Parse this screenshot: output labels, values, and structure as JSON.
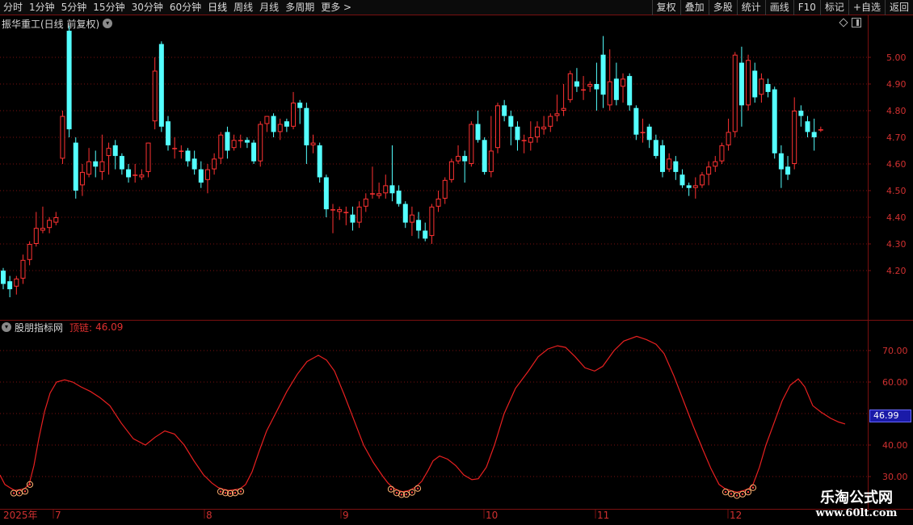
{
  "toolbar": {
    "periods": [
      "分时",
      "1分钟",
      "5分钟",
      "15分钟",
      "30分钟",
      "60分钟",
      "日线",
      "周线",
      "月线",
      "多周期",
      "更多 >"
    ],
    "active_period": "日线",
    "right_buttons": [
      "复权",
      "叠加",
      "多股",
      "统计",
      "画线",
      "F10",
      "标记",
      "+自选",
      "返回"
    ]
  },
  "main_chart": {
    "title": "振华重工(日线 前复权)",
    "price_ticks": [
      "5.00",
      "4.90",
      "4.80",
      "4.70",
      "4.60",
      "4.50",
      "4.40",
      "4.30",
      "4.20"
    ]
  },
  "sub_chart": {
    "title": "股朋指标网",
    "indicator_label": "顶链:",
    "indicator_value": "46.09",
    "ticks": [
      "70.00",
      "60.00",
      "40.00",
      "30.00"
    ],
    "current_value_box": "46.99"
  },
  "date_axis": [
    "2025年",
    "7",
    "8",
    "9",
    "10",
    "11",
    "12"
  ],
  "watermark": {
    "line1": "乐淘公式网",
    "line2": "www.60lt.com"
  },
  "colors": {
    "up": "#ff3232",
    "down": "#54ffff",
    "indicator": "#e82020",
    "grid": "#7a1010",
    "axis_text": "#d03030"
  },
  "chart_data": [
    {
      "type": "candlestick",
      "title": "振华重工(日线 前复权)",
      "ylim": [
        4.07,
        5.13
      ],
      "candles": [
        [
          4.2,
          4.15,
          4.21,
          4.13
        ],
        [
          4.16,
          4.13,
          4.18,
          4.1
        ],
        [
          4.14,
          4.17,
          4.18,
          4.11
        ],
        [
          4.17,
          4.24,
          4.26,
          4.15
        ],
        [
          4.24,
          4.3,
          4.31,
          4.22
        ],
        [
          4.3,
          4.36,
          4.42,
          4.29
        ],
        [
          4.35,
          4.36,
          4.44,
          4.34
        ],
        [
          4.36,
          4.39,
          4.4,
          4.34
        ],
        [
          4.38,
          4.4,
          4.42,
          4.37
        ],
        [
          4.62,
          4.78,
          4.8,
          4.6
        ],
        [
          5.1,
          4.73,
          5.12,
          4.7
        ],
        [
          4.68,
          4.5,
          4.7,
          4.47
        ],
        [
          4.52,
          4.57,
          4.6,
          4.48
        ],
        [
          4.56,
          4.61,
          4.66,
          4.55
        ],
        [
          4.61,
          4.59,
          4.65,
          4.55
        ],
        [
          4.57,
          4.61,
          4.71,
          4.54
        ],
        [
          4.63,
          4.66,
          4.68,
          4.56
        ],
        [
          4.67,
          4.63,
          4.69,
          4.58
        ],
        [
          4.63,
          4.58,
          4.64,
          4.56
        ],
        [
          4.58,
          4.55,
          4.6,
          4.53
        ],
        [
          4.56,
          4.56,
          4.6,
          4.53
        ],
        [
          4.55,
          4.56,
          4.58,
          4.54
        ],
        [
          4.57,
          4.68,
          4.68,
          4.55
        ],
        [
          4.76,
          4.95,
          5.0,
          4.73
        ],
        [
          5.05,
          4.74,
          5.06,
          4.72
        ],
        [
          4.76,
          4.67,
          4.78,
          4.65
        ],
        [
          4.66,
          4.66,
          4.7,
          4.62
        ],
        [
          4.65,
          4.65,
          4.67,
          4.62
        ],
        [
          4.65,
          4.61,
          4.66,
          4.59
        ],
        [
          4.62,
          4.58,
          4.65,
          4.56
        ],
        [
          4.58,
          4.53,
          4.61,
          4.51
        ],
        [
          4.54,
          4.58,
          4.6,
          4.49
        ],
        [
          4.58,
          4.62,
          4.64,
          4.56
        ],
        [
          4.62,
          4.71,
          4.72,
          4.6
        ],
        [
          4.72,
          4.65,
          4.74,
          4.62
        ],
        [
          4.66,
          4.69,
          4.71,
          4.65
        ],
        [
          4.69,
          4.69,
          4.71,
          4.66
        ],
        [
          4.69,
          4.68,
          4.7,
          4.66
        ],
        [
          4.68,
          4.61,
          4.69,
          4.6
        ],
        [
          4.61,
          4.75,
          4.76,
          4.59
        ],
        [
          4.75,
          4.78,
          4.78,
          4.72
        ],
        [
          4.78,
          4.72,
          4.79,
          4.7
        ],
        [
          4.72,
          4.75,
          4.77,
          4.69
        ],
        [
          4.76,
          4.74,
          4.77,
          4.72
        ],
        [
          4.74,
          4.83,
          4.87,
          4.73
        ],
        [
          4.83,
          4.81,
          4.84,
          4.75
        ],
        [
          4.81,
          4.67,
          4.83,
          4.6
        ],
        [
          4.67,
          4.68,
          4.71,
          4.64
        ],
        [
          4.67,
          4.55,
          4.68,
          4.53
        ],
        [
          4.55,
          4.43,
          4.56,
          4.4
        ],
        [
          4.43,
          4.43,
          4.45,
          4.34
        ],
        [
          4.42,
          4.43,
          4.44,
          4.39
        ],
        [
          4.42,
          4.42,
          4.44,
          4.37
        ],
        [
          4.41,
          4.38,
          4.44,
          4.35
        ],
        [
          4.38,
          4.44,
          4.46,
          4.36
        ],
        [
          4.44,
          4.47,
          4.49,
          4.42
        ],
        [
          4.49,
          4.49,
          4.59,
          4.47
        ],
        [
          4.48,
          4.49,
          4.53,
          4.47
        ],
        [
          4.49,
          4.52,
          4.56,
          4.47
        ],
        [
          4.52,
          4.49,
          4.67,
          4.46
        ],
        [
          4.5,
          4.45,
          4.52,
          4.44
        ],
        [
          4.45,
          4.38,
          4.46,
          4.36
        ],
        [
          4.38,
          4.41,
          4.44,
          4.33
        ],
        [
          4.39,
          4.35,
          4.42,
          4.32
        ],
        [
          4.35,
          4.32,
          4.38,
          4.31
        ],
        [
          4.33,
          4.44,
          4.45,
          4.3
        ],
        [
          4.44,
          4.47,
          4.5,
          4.42
        ],
        [
          4.47,
          4.54,
          4.55,
          4.45
        ],
        [
          4.54,
          4.61,
          4.62,
          4.53
        ],
        [
          4.61,
          4.63,
          4.67,
          4.6
        ],
        [
          4.63,
          4.61,
          4.65,
          4.53
        ],
        [
          4.6,
          4.75,
          4.76,
          4.59
        ],
        [
          4.75,
          4.69,
          4.8,
          4.68
        ],
        [
          4.69,
          4.57,
          4.7,
          4.56
        ],
        [
          4.57,
          4.65,
          4.78,
          4.55
        ],
        [
          4.66,
          4.82,
          4.83,
          4.64
        ],
        [
          4.82,
          4.78,
          4.84,
          4.76
        ],
        [
          4.78,
          4.74,
          4.8,
          4.67
        ],
        [
          4.74,
          4.69,
          4.76,
          4.65
        ],
        [
          4.69,
          4.69,
          4.71,
          4.64
        ],
        [
          4.68,
          4.7,
          4.76,
          4.65
        ],
        [
          4.7,
          4.74,
          4.76,
          4.68
        ],
        [
          4.73,
          4.74,
          4.78,
          4.71
        ],
        [
          4.74,
          4.78,
          4.79,
          4.72
        ],
        [
          4.78,
          4.79,
          4.86,
          4.76
        ],
        [
          4.8,
          4.81,
          4.9,
          4.78
        ],
        [
          4.84,
          4.94,
          4.95,
          4.83
        ],
        [
          4.91,
          4.89,
          4.96,
          4.87
        ],
        [
          4.88,
          4.88,
          4.93,
          4.84
        ],
        [
          4.89,
          4.9,
          4.91,
          4.87
        ],
        [
          4.9,
          4.88,
          4.98,
          4.8
        ],
        [
          5.01,
          4.86,
          5.08,
          4.81
        ],
        [
          4.82,
          4.91,
          5.03,
          4.8
        ],
        [
          4.92,
          4.84,
          4.98,
          4.82
        ],
        [
          4.89,
          4.92,
          4.94,
          4.83
        ],
        [
          4.93,
          4.82,
          4.94,
          4.8
        ],
        [
          4.81,
          4.71,
          4.82,
          4.69
        ],
        [
          4.72,
          4.72,
          4.77,
          4.68
        ],
        [
          4.74,
          4.69,
          4.75,
          4.66
        ],
        [
          4.69,
          4.63,
          4.71,
          4.62
        ],
        [
          4.67,
          4.57,
          4.69,
          4.55
        ],
        [
          4.58,
          4.62,
          4.64,
          4.57
        ],
        [
          4.61,
          4.57,
          4.63,
          4.54
        ],
        [
          4.56,
          4.52,
          4.58,
          4.51
        ],
        [
          4.52,
          4.51,
          4.53,
          4.48
        ],
        [
          4.51,
          4.52,
          4.55,
          4.47
        ],
        [
          4.52,
          4.56,
          4.57,
          4.51
        ],
        [
          4.56,
          4.59,
          4.61,
          4.52
        ],
        [
          4.59,
          4.61,
          4.63,
          4.57
        ],
        [
          4.61,
          4.67,
          4.68,
          4.6
        ],
        [
          4.67,
          4.72,
          4.77,
          4.65
        ],
        [
          4.72,
          5.01,
          5.02,
          4.7
        ],
        [
          4.98,
          4.82,
          5.04,
          4.74
        ],
        [
          4.82,
          4.99,
          5.01,
          4.8
        ],
        [
          4.95,
          4.85,
          4.98,
          4.83
        ],
        [
          4.86,
          4.92,
          4.94,
          4.83
        ],
        [
          4.9,
          4.87,
          4.92,
          4.85
        ],
        [
          4.88,
          4.64,
          4.89,
          4.62
        ],
        [
          4.64,
          4.58,
          4.67,
          4.51
        ],
        [
          4.59,
          4.56,
          4.63,
          4.54
        ],
        [
          4.6,
          4.8,
          4.85,
          4.58
        ],
        [
          4.8,
          4.78,
          4.82,
          4.74
        ],
        [
          4.76,
          4.72,
          4.78,
          4.7
        ],
        [
          4.72,
          4.7,
          4.77,
          4.65
        ],
        [
          4.73,
          4.73,
          4.74,
          4.72
        ]
      ]
    },
    {
      "type": "line",
      "series": [
        {
          "name": "顶链",
          "color": "#e82020"
        }
      ],
      "ylim": [
        24,
        77
      ],
      "points": [
        [
          0,
          30.5
        ],
        [
          6,
          27.5
        ],
        [
          12,
          26.5
        ],
        [
          18,
          25.6
        ],
        [
          24,
          25.8
        ],
        [
          30,
          26.1
        ],
        [
          36,
          27.5
        ],
        [
          42,
          33.5
        ],
        [
          48,
          42.0
        ],
        [
          55,
          50.5
        ],
        [
          62,
          56.5
        ],
        [
          70,
          60.0
        ],
        [
          80,
          60.7
        ],
        [
          90,
          60.0
        ],
        [
          100,
          58.5
        ],
        [
          112,
          57.0
        ],
        [
          124,
          55.0
        ],
        [
          136,
          52.5
        ],
        [
          150,
          47.0
        ],
        [
          165,
          42.0
        ],
        [
          180,
          40.0
        ],
        [
          192,
          42.5
        ],
        [
          204,
          44.5
        ],
        [
          216,
          43.5
        ],
        [
          228,
          40.0
        ],
        [
          240,
          35.0
        ],
        [
          252,
          30.5
        ],
        [
          262,
          28.0
        ],
        [
          270,
          26.5
        ],
        [
          276,
          26.0
        ],
        [
          283,
          25.6
        ],
        [
          290,
          25.8
        ],
        [
          297,
          26.1
        ],
        [
          304,
          27.5
        ],
        [
          312,
          31.5
        ],
        [
          320,
          37.5
        ],
        [
          330,
          44.5
        ],
        [
          342,
          50.5
        ],
        [
          355,
          57.0
        ],
        [
          368,
          62.5
        ],
        [
          380,
          66.5
        ],
        [
          394,
          68.5
        ],
        [
          404,
          67.0
        ],
        [
          414,
          63.5
        ],
        [
          426,
          56.0
        ],
        [
          438,
          48.0
        ],
        [
          450,
          40.0
        ],
        [
          462,
          34.5
        ],
        [
          474,
          30.0
        ],
        [
          480,
          28.0
        ],
        [
          486,
          26.5
        ],
        [
          492,
          25.7
        ],
        [
          498,
          25.2
        ],
        [
          504,
          25.4
        ],
        [
          510,
          26.0
        ],
        [
          516,
          27.0
        ],
        [
          522,
          28.5
        ],
        [
          530,
          32.0
        ],
        [
          536,
          35.0
        ],
        [
          544,
          36.5
        ],
        [
          554,
          35.5
        ],
        [
          564,
          33.5
        ],
        [
          574,
          30.5
        ],
        [
          584,
          29.0
        ],
        [
          592,
          29.3
        ],
        [
          602,
          33.0
        ],
        [
          612,
          40.0
        ],
        [
          624,
          50.0
        ],
        [
          638,
          58.0
        ],
        [
          654,
          63.5
        ],
        [
          666,
          68.0
        ],
        [
          678,
          70.5
        ],
        [
          690,
          71.5
        ],
        [
          700,
          71.0
        ],
        [
          712,
          68.0
        ],
        [
          724,
          64.5
        ],
        [
          736,
          63.5
        ],
        [
          746,
          65.0
        ],
        [
          760,
          70.0
        ],
        [
          772,
          73.0
        ],
        [
          788,
          74.5
        ],
        [
          800,
          73.5
        ],
        [
          812,
          72.0
        ],
        [
          822,
          69.0
        ],
        [
          834,
          62.0
        ],
        [
          846,
          54.0
        ],
        [
          858,
          46.0
        ],
        [
          870,
          38.5
        ],
        [
          880,
          32.5
        ],
        [
          890,
          27.5
        ],
        [
          897,
          26.2
        ],
        [
          904,
          25.6
        ],
        [
          912,
          25.0
        ],
        [
          920,
          25.5
        ],
        [
          927,
          26.2
        ],
        [
          932,
          27.5
        ],
        [
          940,
          33.0
        ],
        [
          948,
          40.0
        ],
        [
          958,
          47.0
        ],
        [
          968,
          54.0
        ],
        [
          978,
          59.0
        ],
        [
          988,
          61.0
        ],
        [
          996,
          58.5
        ],
        [
          1006,
          52.5
        ],
        [
          1016,
          50.5
        ],
        [
          1028,
          48.5
        ],
        [
          1038,
          47.3
        ],
        [
          1046,
          46.7
        ]
      ],
      "markers_x": [
        17,
        24,
        31,
        37,
        273,
        279,
        285,
        291,
        298,
        484,
        491,
        497,
        503,
        510,
        517,
        898,
        905,
        912,
        919,
        926,
        932
      ]
    }
  ]
}
